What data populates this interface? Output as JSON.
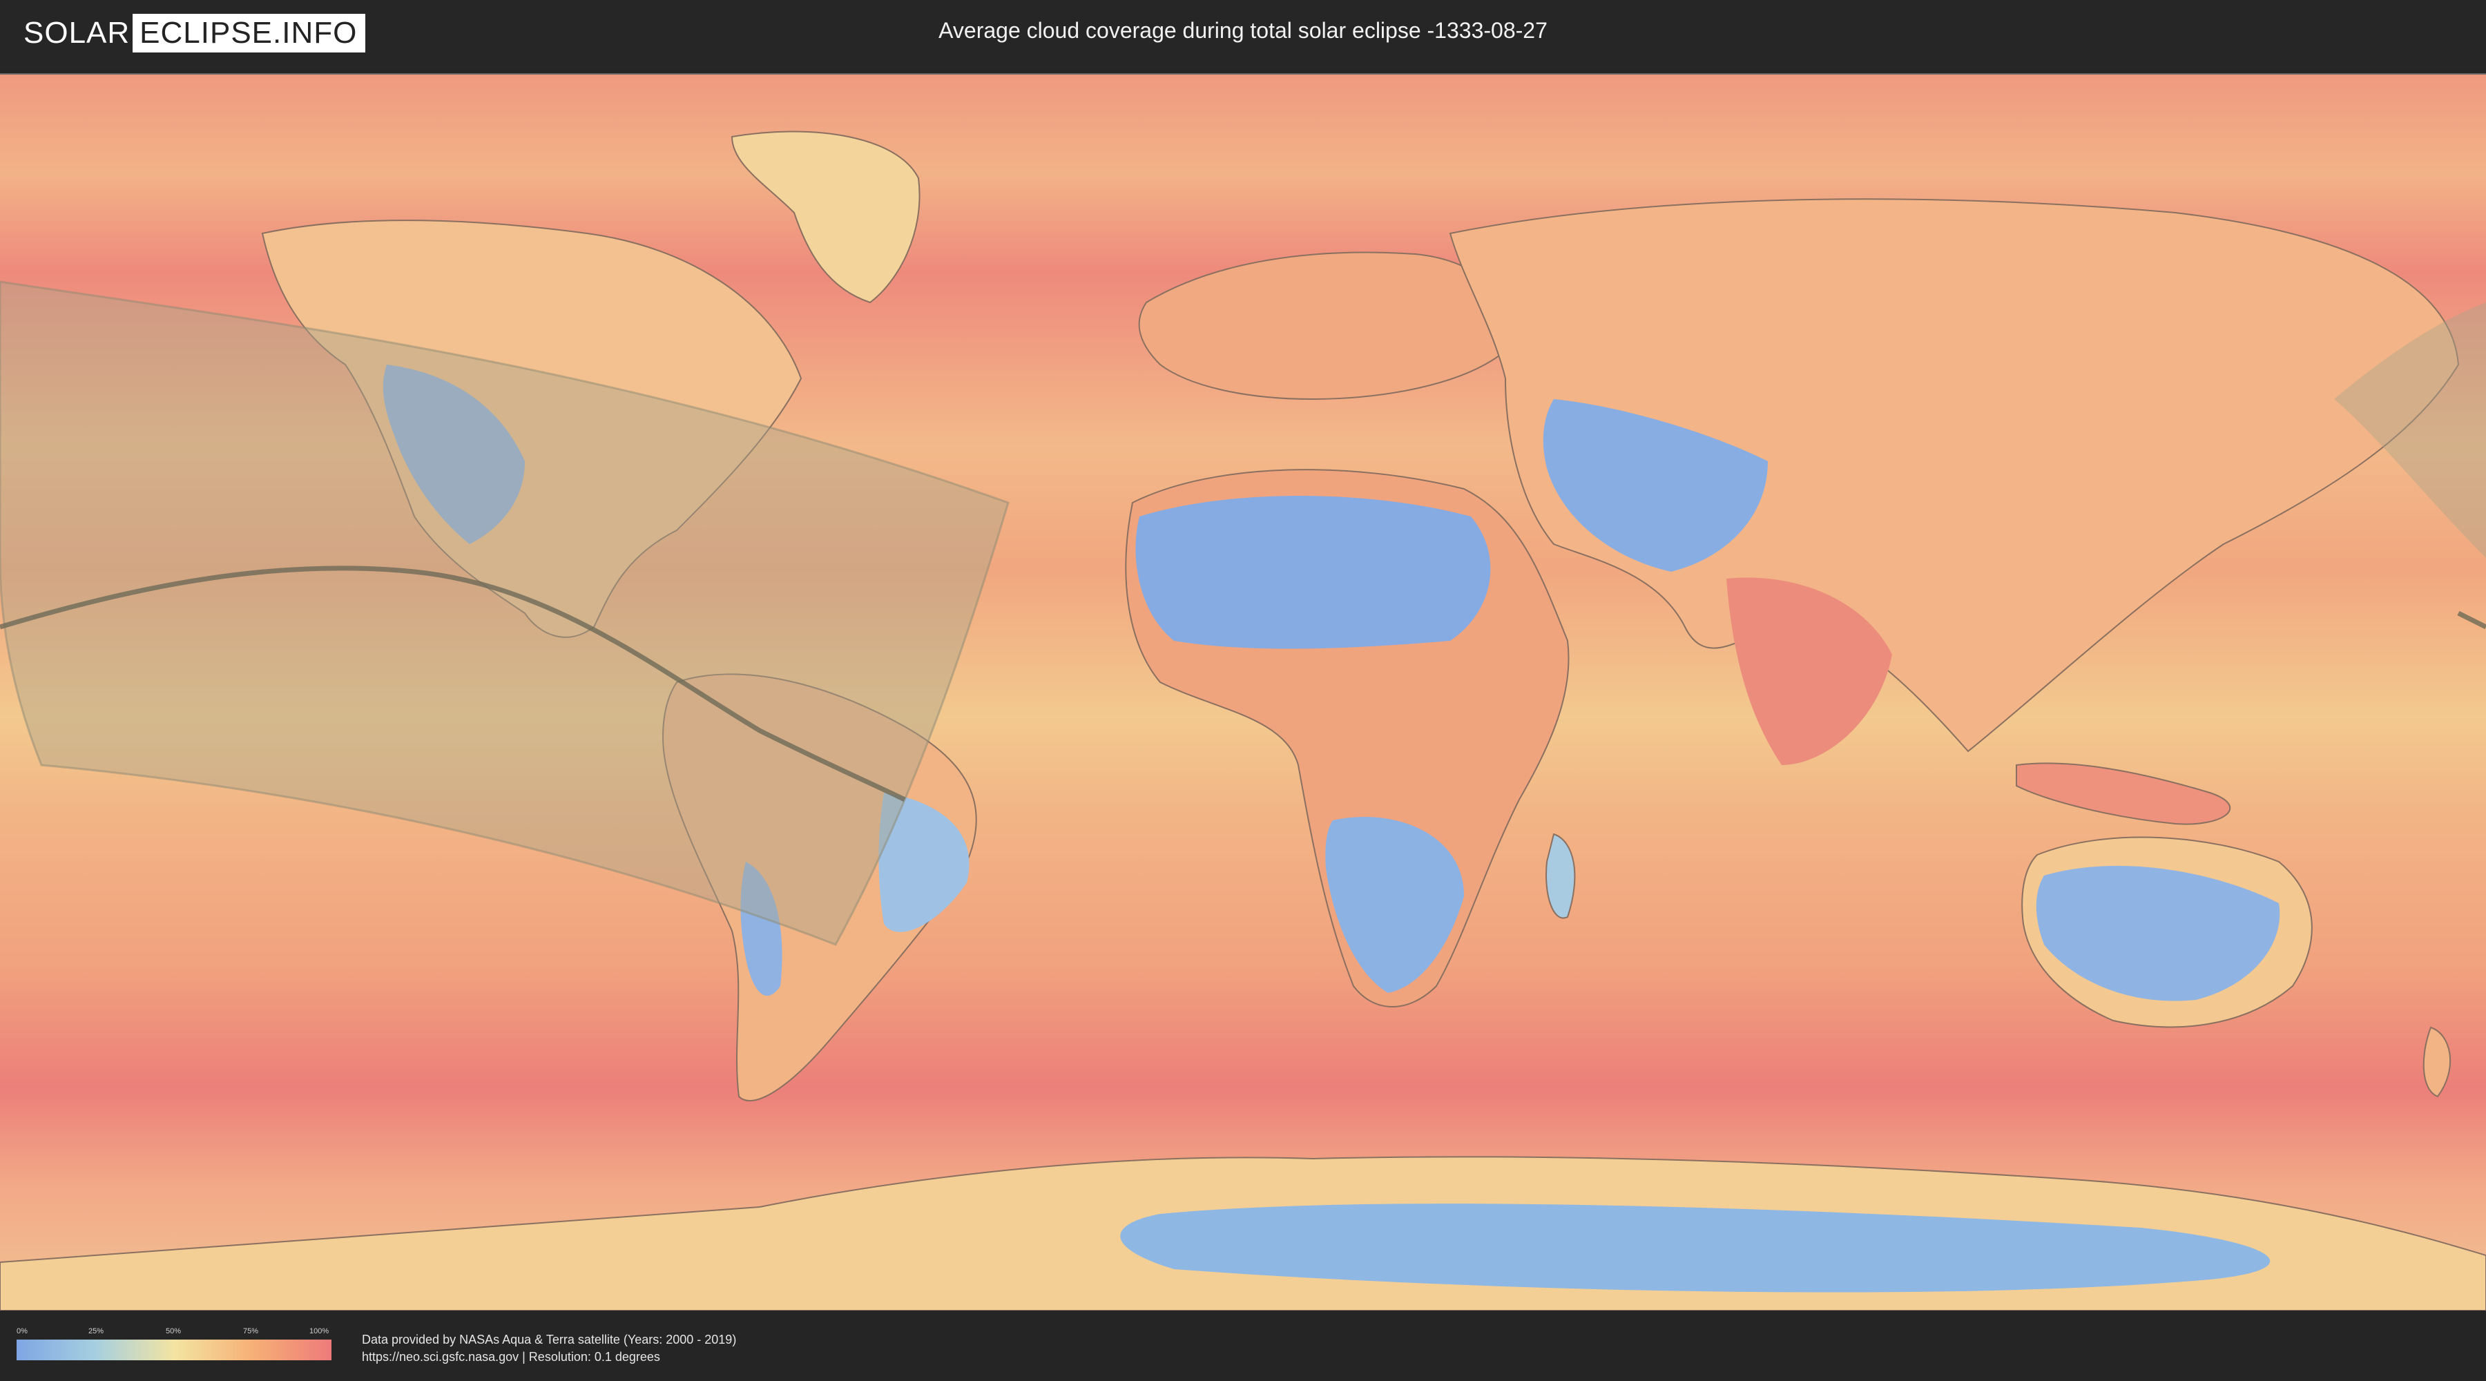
{
  "header": {
    "logo_left": "SOLAR",
    "logo_right": "ECLIPSE.INFO",
    "title": "Average cloud coverage during total solar eclipse -1333-08-27"
  },
  "legend": {
    "ticks": [
      "0%",
      "25%",
      "50%",
      "75%",
      "100%"
    ],
    "colors": [
      "#7fa6e3",
      "#a6cfe0",
      "#f3e4a2",
      "#f6b076",
      "#ee7a7a"
    ]
  },
  "credits": {
    "line1": "Data provided by NASAs Aqua & Terra satellite (Years: 2000 - 2019)",
    "line2": "https://neo.sci.gsfc.nasa.gov | Resolution: 0.1 degrees"
  },
  "palette": {
    "ocean": "#f0a27d",
    "cloudy": "#ef8a7c",
    "clear": "#86abe3",
    "mid": "#f3d79a",
    "eclipse_band": "#a9a58a",
    "central_line": "#6e6a58"
  }
}
